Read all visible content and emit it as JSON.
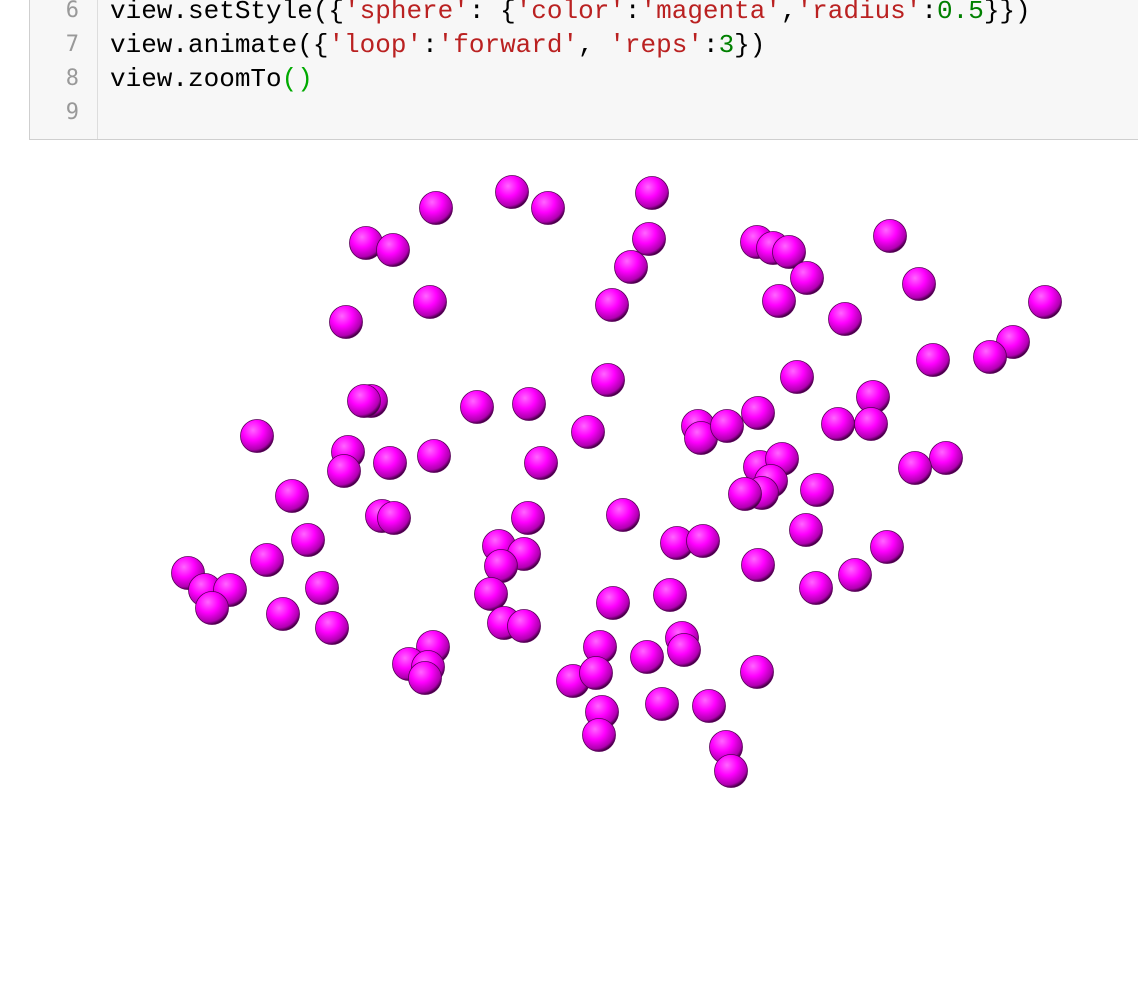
{
  "code_cell": {
    "lines": [
      {
        "number": "6",
        "tokens": [
          {
            "t": "plain",
            "v": "view.setStyle({"
          },
          {
            "t": "string",
            "v": "'sphere'"
          },
          {
            "t": "plain",
            "v": ": {"
          },
          {
            "t": "string",
            "v": "'color'"
          },
          {
            "t": "plain",
            "v": ":"
          },
          {
            "t": "string",
            "v": "'magenta'"
          },
          {
            "t": "plain",
            "v": ","
          },
          {
            "t": "string",
            "v": "'radius'"
          },
          {
            "t": "plain",
            "v": ":"
          },
          {
            "t": "number",
            "v": "0.5"
          },
          {
            "t": "plain",
            "v": "}})"
          }
        ]
      },
      {
        "number": "7",
        "tokens": [
          {
            "t": "plain",
            "v": "view.animate({"
          },
          {
            "t": "string",
            "v": "'loop'"
          },
          {
            "t": "plain",
            "v": ":"
          },
          {
            "t": "string",
            "v": "'forward'"
          },
          {
            "t": "plain",
            "v": ", "
          },
          {
            "t": "string",
            "v": "'reps'"
          },
          {
            "t": "plain",
            "v": ":"
          },
          {
            "t": "number",
            "v": "3"
          },
          {
            "t": "plain",
            "v": "})"
          }
        ]
      },
      {
        "number": "8",
        "tokens": [
          {
            "t": "plain",
            "v": "view.zoomTo"
          },
          {
            "t": "paren",
            "v": "()"
          }
        ]
      },
      {
        "number": "9",
        "tokens": []
      }
    ]
  },
  "viewer": {
    "sphere_color": "#ff00ff",
    "sphere_count": 103
  }
}
